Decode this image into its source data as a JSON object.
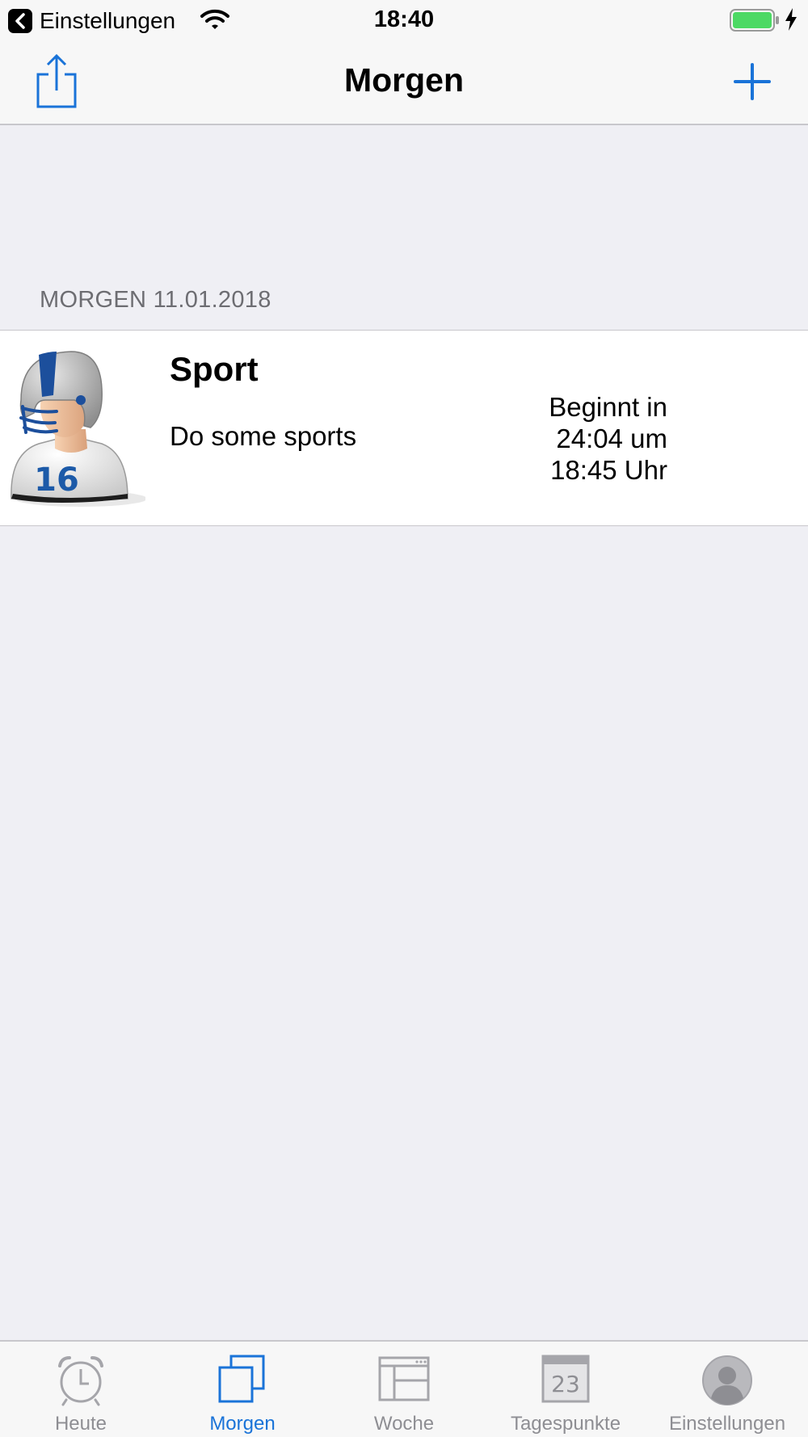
{
  "status_bar": {
    "back_app": "Einstellungen",
    "time": "18:40"
  },
  "nav": {
    "title": "Morgen"
  },
  "section": {
    "header": "MORGEN 11.01.2018"
  },
  "items": [
    {
      "title": "Sport",
      "subtitle": "Do some sports",
      "meta_line1": "Beginnt in",
      "meta_line2": "24:04 um",
      "meta_line3": "18:45 Uhr",
      "avatar_number": "16"
    }
  ],
  "tabs": [
    {
      "label": "Heute",
      "icon": "alarm-clock-icon"
    },
    {
      "label": "Morgen",
      "icon": "stacked-squares-icon"
    },
    {
      "label": "Woche",
      "icon": "week-layout-icon"
    },
    {
      "label": "Tagespunkte",
      "icon": "calendar-icon",
      "icon_text": "23"
    },
    {
      "label": "Einstellungen",
      "icon": "person-icon"
    }
  ],
  "active_tab": "Morgen",
  "colors": {
    "accent": "#1a73d8",
    "inactive": "#8e8e93",
    "background": "#efeff4"
  }
}
